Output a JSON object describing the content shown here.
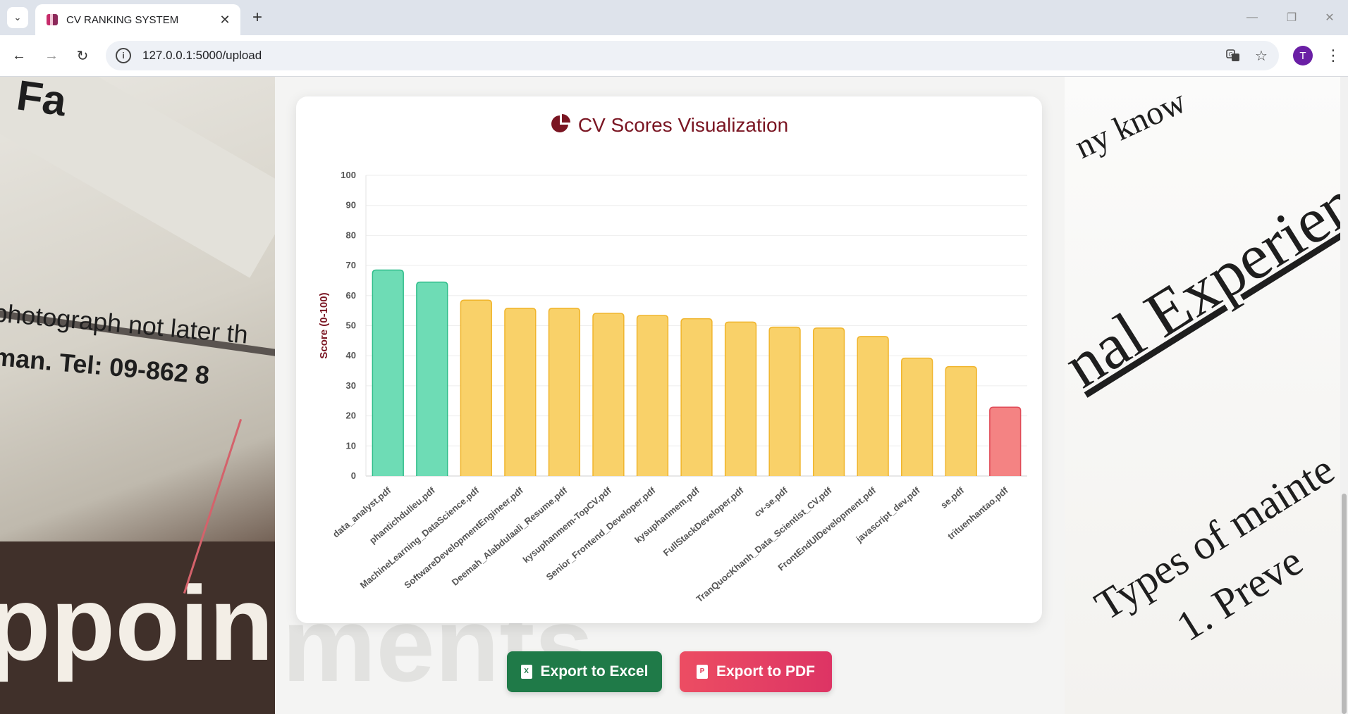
{
  "browser": {
    "tab_title": "CV RANKING SYSTEM",
    "url": "127.0.0.1:5000/upload",
    "profile_initial": "T",
    "icons": [
      "tab-list-icon",
      "favicon-icon",
      "close-icon",
      "plus-icon",
      "minimize-icon",
      "restore-icon",
      "close-window-icon",
      "back-icon",
      "forward-icon",
      "reload-icon",
      "site-info-icon",
      "translate-icon",
      "bookmark-star-icon",
      "kebab-menu-icon"
    ]
  },
  "background": {
    "left_lines": [
      "Fa",
      "photograph not later th",
      "man.   Tel: 09-862 8",
      "ppointm"
    ],
    "center_word": "ments",
    "right_lines": [
      "ny know",
      "nal Experienc",
      "Types of mainte",
      "1.   Preve"
    ]
  },
  "card": {
    "title": "CV Scores Visualization",
    "title_icon": "pie-chart-icon"
  },
  "chart_data": {
    "type": "bar",
    "title": "CV Scores Visualization",
    "ylabel": "Score (0-100)",
    "xlabel": "",
    "ylim": [
      0,
      100
    ],
    "yticks": [
      0,
      10,
      20,
      30,
      40,
      50,
      60,
      70,
      80,
      90,
      100
    ],
    "grid": true,
    "categories": [
      "data_analyst.pdf",
      "phantichdulieu.pdf",
      "MachineLearning_DataScience.pdf",
      "SoftwareDevelopmentEngineer.pdf",
      "Deemah_Alabdulaali_Resume.pdf",
      "kysuphanmem-TopCV.pdf",
      "Senior_Frontend_Developer.pdf",
      "kysuphanmem.pdf",
      "FullStackDeveloper.pdf",
      "cv-se.pdf",
      "TranQuocKhanh_Data_Scientist_CV.pdf",
      "FrontEndUIDevelopment.pdf",
      "javascript_dev.pdf",
      "se.pdf",
      "trituenhantao.pdf"
    ],
    "values": [
      68.5,
      64.5,
      58.5,
      55.8,
      55.8,
      54.1,
      53.4,
      52.3,
      51.2,
      49.5,
      49.2,
      46.4,
      39.2,
      36.4,
      22.9
    ],
    "bar_fills": [
      "#6edcb5",
      "#6edcb5",
      "#f9d169",
      "#f9d169",
      "#f9d169",
      "#f9d169",
      "#f9d169",
      "#f9d169",
      "#f9d169",
      "#f9d169",
      "#f9d169",
      "#f9d169",
      "#f9d169",
      "#f9d169",
      "#f48383"
    ],
    "bar_strokes": [
      "#2fbd8a",
      "#2fbd8a",
      "#f0b52d",
      "#f0b52d",
      "#f0b52d",
      "#f0b52d",
      "#f0b52d",
      "#f0b52d",
      "#f0b52d",
      "#f0b52d",
      "#f0b52d",
      "#f0b52d",
      "#f0b52d",
      "#f0b52d",
      "#e04a57"
    ]
  },
  "actions": {
    "export_excel": "Export to Excel",
    "export_pdf": "Export to PDF"
  },
  "colors": {
    "title": "#7a1522",
    "excel_button": "#1f7a48",
    "pdf_button": "#e4405d"
  }
}
